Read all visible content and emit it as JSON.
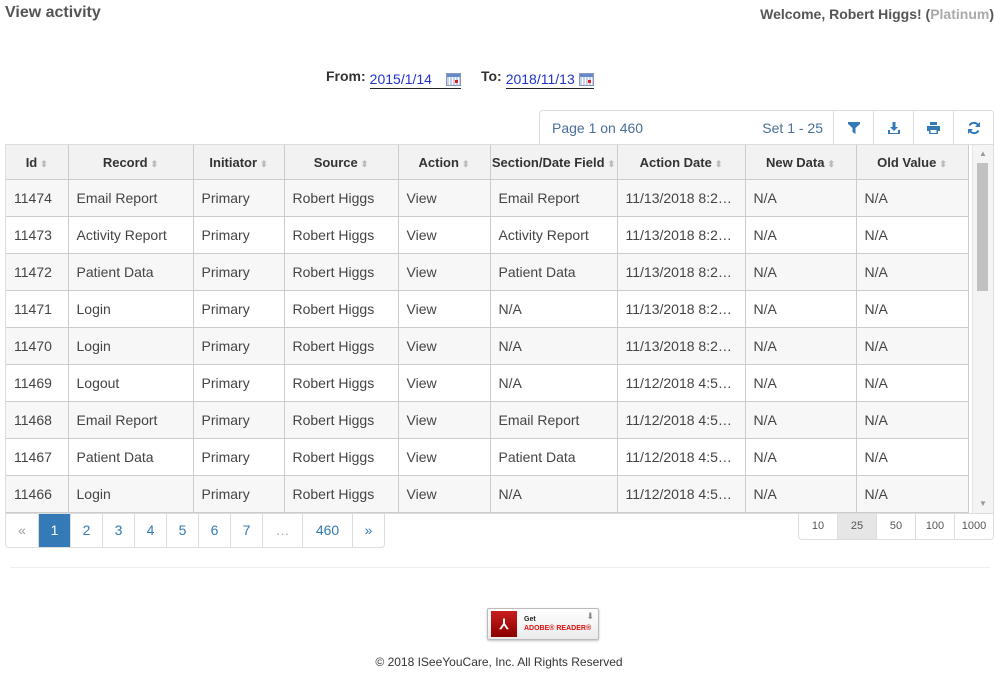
{
  "header": {
    "title": "View activity",
    "welcome_prefix": "Welcome, Robert Higgs! (",
    "tier": "Platinum",
    "welcome_suffix": ")"
  },
  "filters": {
    "from_label": "From:",
    "from_value": "2015/1/14",
    "to_label": "To:",
    "to_value": "2018/11/13"
  },
  "toolbar": {
    "page_info": "Page 1 on 460",
    "set_info": "Set 1 - 25",
    "buttons": [
      {
        "name": "filter",
        "icon": "filter-icon"
      },
      {
        "name": "download",
        "icon": "download-icon"
      },
      {
        "name": "print",
        "icon": "print-icon"
      },
      {
        "name": "refresh",
        "icon": "refresh-icon"
      }
    ]
  },
  "table": {
    "columns": [
      "Id",
      "Record",
      "Initiator",
      "Source",
      "Action",
      "Section/Date Field",
      "Action Date",
      "New Data",
      "Old Value"
    ],
    "rows": [
      [
        "11474",
        "Email Report",
        "Primary",
        "Robert Higgs",
        "View",
        "Email Report",
        "11/13/2018 8:2…",
        "N/A",
        "N/A"
      ],
      [
        "11473",
        "Activity Report",
        "Primary",
        "Robert Higgs",
        "View",
        "Activity Report",
        "11/13/2018 8:2…",
        "N/A",
        "N/A"
      ],
      [
        "11472",
        "Patient Data",
        "Primary",
        "Robert Higgs",
        "View",
        "Patient Data",
        "11/13/2018 8:2…",
        "N/A",
        "N/A"
      ],
      [
        "11471",
        "Login",
        "Primary",
        "Robert Higgs",
        "View",
        "N/A",
        "11/13/2018 8:2…",
        "N/A",
        "N/A"
      ],
      [
        "11470",
        "Login",
        "Primary",
        "Robert Higgs",
        "View",
        "N/A",
        "11/13/2018 8:2…",
        "N/A",
        "N/A"
      ],
      [
        "11469",
        "Logout",
        "Primary",
        "Robert Higgs",
        "View",
        "N/A",
        "11/12/2018 4:5…",
        "N/A",
        "N/A"
      ],
      [
        "11468",
        "Email Report",
        "Primary",
        "Robert Higgs",
        "View",
        "Email Report",
        "11/12/2018 4:5…",
        "N/A",
        "N/A"
      ],
      [
        "11467",
        "Patient Data",
        "Primary",
        "Robert Higgs",
        "View",
        "Patient Data",
        "11/12/2018 4:5…",
        "N/A",
        "N/A"
      ],
      [
        "11466",
        "Login",
        "Primary",
        "Robert Higgs",
        "View",
        "N/A",
        "11/12/2018 4:5…",
        "N/A",
        "N/A"
      ]
    ]
  },
  "pagination": {
    "pages": [
      "«",
      "1",
      "2",
      "3",
      "4",
      "5",
      "6",
      "7",
      "…",
      "460",
      "»"
    ],
    "active": "1"
  },
  "page_sizes": {
    "options": [
      "10",
      "25",
      "50",
      "100",
      "1000"
    ],
    "active": "25"
  },
  "footer": {
    "adobe_get": "Get",
    "adobe_name": "ADOBE® READER®",
    "copyright": "© 2018 ISeeYouCare, Inc. All Rights Reserved"
  }
}
